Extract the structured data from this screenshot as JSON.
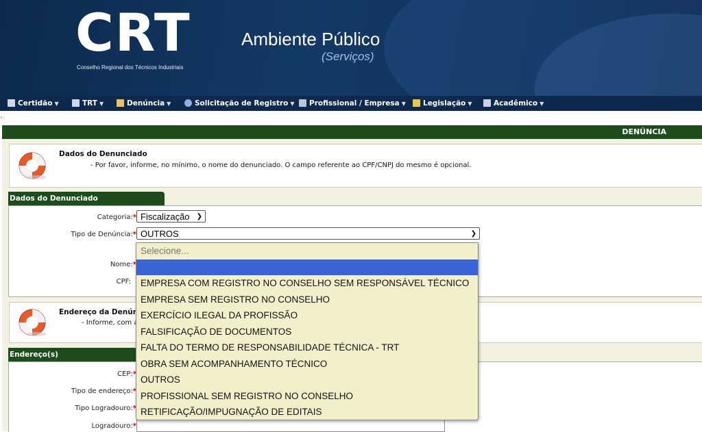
{
  "header": {
    "logo": "CRT",
    "logo_subtitle": "Conselho Regional dos Técnicos Industriais",
    "title": "Ambiente Público",
    "subtitle": "(Serviços)"
  },
  "nav": [
    {
      "label": "Certidão",
      "icon": "document-icon"
    },
    {
      "label": "TRT",
      "icon": "document-icon"
    },
    {
      "label": "Denúncia",
      "icon": "folder-icon"
    },
    {
      "label": "Solicitação de Registro",
      "icon": "user-icon"
    },
    {
      "label": "Profissional / Empresa",
      "icon": "id-card-icon"
    },
    {
      "label": "Legislação",
      "icon": "law-icon"
    },
    {
      "label": "Acadêmico",
      "icon": "book-icon"
    }
  ],
  "page": {
    "section_title": "DENÚNCIA",
    "info1": {
      "title": "Dados do Denunciado",
      "text": "- Por favor, informe, no mínimo, o nome do denunciado. O campo referente ao CPF/CNPJ do mesmo é opcional."
    },
    "tab1": "Dados do Denunciado",
    "form1": {
      "categoria_label": "Categoria:",
      "categoria_value": "Fiscalização",
      "tipo_label": "Tipo de Denúncia:",
      "tipo_value": "OUTROS",
      "nome_label": "Nome:",
      "cpf_label": "CPF:"
    },
    "info2": {
      "title": "Endereço da Denúnci",
      "text": "- Informe, com a"
    },
    "tab2": "Endereço(s)",
    "form2": {
      "cep_label": "CEP:",
      "tipo_endereco_label": "Tipo de endereço:",
      "tipo_logradouro_label": "Tipo Logradouro:",
      "logradouro_label": "Logradouro:"
    },
    "required_mark": "*"
  },
  "dropdown": {
    "placeholder": "Selecione...",
    "options": [
      "",
      "EMPRESA COM REGISTRO NO CONSELHO SEM RESPONSÁVEL TÉCNICO",
      "EMPRESA SEM REGISTRO NO CONSELHO",
      "EXERCÍCIO ILEGAL DA PROFISSÃO",
      "FALSIFICAÇÃO DE DOCUMENTOS",
      "FALTA DO TERMO DE RESPONSABILIDADE TÉCNICA - TRT",
      "OBRA SEM ACOMPANHAMENTO TÉCNICO",
      "OUTROS",
      "PROFISSIONAL SEM REGISTRO NO CONSELHO",
      "RETIFICAÇÃO/IMPUGNAÇÃO DE EDITAIS"
    ]
  },
  "colors": {
    "header_bg": "#133a66",
    "nav_bg": "#0d2a4e",
    "section_green": "#1d4d1d",
    "panel_bg": "#f3f1e2",
    "dropdown_bg": "#f2efcb",
    "highlight": "#3a64d6",
    "required": "#d00000"
  }
}
